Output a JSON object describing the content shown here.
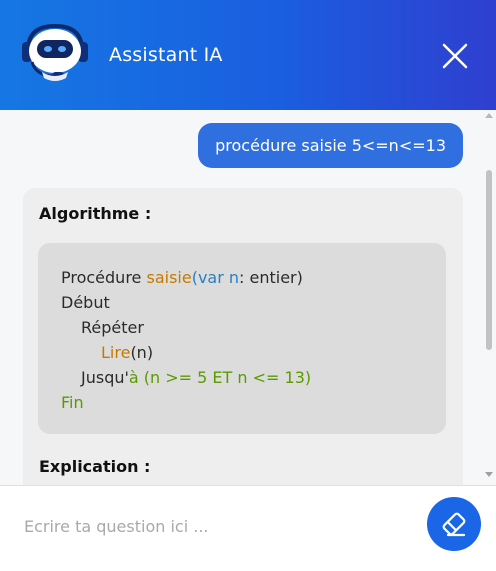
{
  "header": {
    "title": "Assistant IA",
    "avatar_icon": "robot-icon",
    "close_icon": "close-icon"
  },
  "chat": {
    "user_message": "procédure saisie 5<=n<=13",
    "bot": {
      "algorithm_heading": "Algorithme :",
      "code": {
        "l1_kw": "Procédure ",
        "l1_fn": "saisie",
        "l1_paren_open": "(",
        "l1_var": "var n",
        "l1_type": ": entier)",
        "l2": "Début",
        "l3": "Répéter",
        "l4_fn": "Lire",
        "l4_arg": "(n)",
        "l5_kw": "Jusqu'",
        "l5_cond": "à (n >= 5 ET n <= 13)",
        "l6": "Fin"
      },
      "explanation_heading": "Explication :"
    }
  },
  "footer": {
    "input_placeholder": "Ecrire ta question ici ...",
    "input_value": "",
    "clear_icon": "eraser-icon"
  },
  "colors": {
    "header_start": "#1677e3",
    "header_end": "#2f3fd0",
    "user_bubble": "#2f6fe0",
    "code_function": "#c47a00",
    "code_variable": "#2a7fc0",
    "code_keyword_green": "#5a9a00",
    "clear_button": "#1a66e6"
  }
}
